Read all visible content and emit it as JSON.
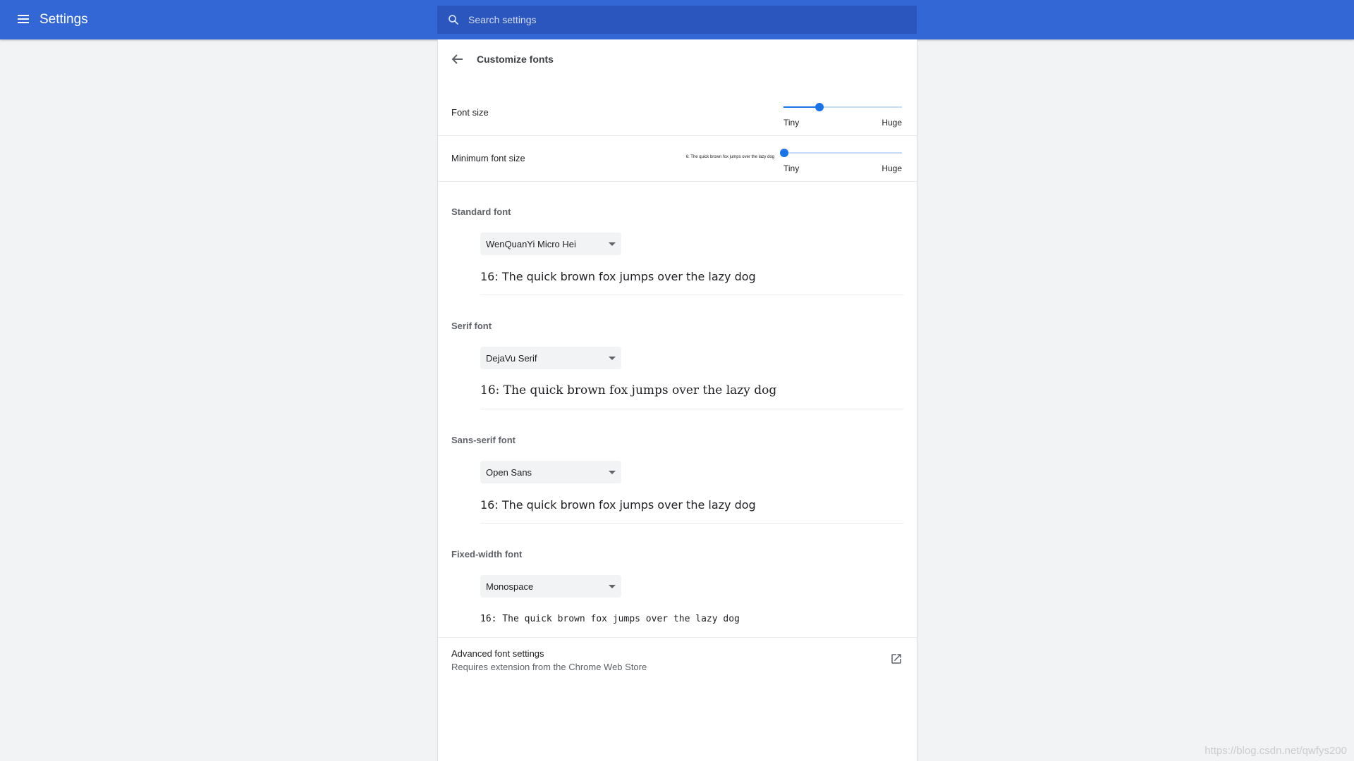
{
  "header": {
    "title": "Settings",
    "search_placeholder": "Search settings"
  },
  "subpage": {
    "title": "Customize fonts"
  },
  "font_size": {
    "label": "Font size",
    "min_label": "Tiny",
    "max_label": "Huge",
    "value_fraction": 0.3
  },
  "min_font_size": {
    "label": "Minimum font size",
    "sample": "6: The quick brown fox jumps over the lazy dog",
    "min_label": "Tiny",
    "max_label": "Huge",
    "value_fraction": 0.0
  },
  "standard_font": {
    "title": "Standard font",
    "selected": "WenQuanYi Micro Hei",
    "sample": "16: The quick brown fox jumps over the lazy dog"
  },
  "serif_font": {
    "title": "Serif font",
    "selected": "DejaVu Serif",
    "sample": "16: The quick brown fox jumps over the lazy dog"
  },
  "sans_serif_font": {
    "title": "Sans-serif font",
    "selected": "Open Sans",
    "sample": "16: The quick brown fox jumps over the lazy dog"
  },
  "fixed_width_font": {
    "title": "Fixed-width font",
    "selected": "Monospace",
    "sample": "16: The quick brown fox jumps over the lazy dog"
  },
  "advanced": {
    "title": "Advanced font settings",
    "subtitle": "Requires extension from the Chrome Web Store"
  },
  "watermark": "https://blog.csdn.net/qwfys200",
  "colors": {
    "header_bg": "#3367d6",
    "accent": "#1a73e8"
  },
  "icons": [
    "menu-icon",
    "search-icon",
    "arrow-back-icon",
    "dropdown-caret-icon",
    "open-in-new-icon"
  ]
}
